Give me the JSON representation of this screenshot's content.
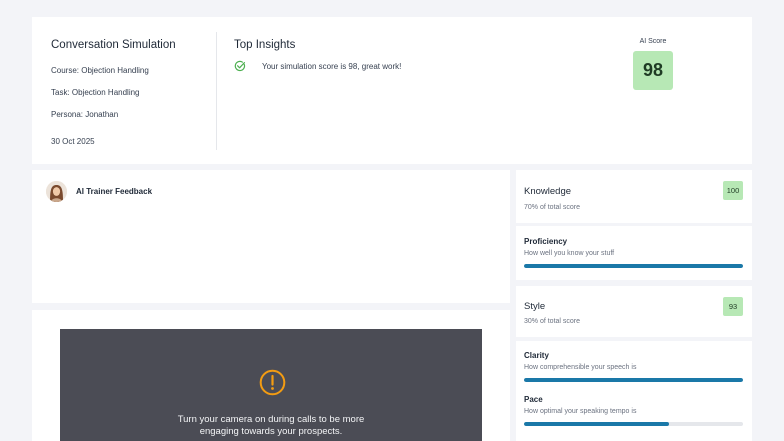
{
  "summary": {
    "title": "Conversation Simulation",
    "course": "Course: Objection Handling",
    "task": "Task: Objection Handling",
    "persona": "Persona: Jonathan",
    "date": "30 Oct 2025",
    "insights_title": "Top Insights",
    "insights": [
      "Your simulation score is 98, great work!"
    ],
    "score_label": "AI Score",
    "score": "98"
  },
  "feedback": {
    "title": "AI Trainer Feedback"
  },
  "video": {
    "message_line1": "Turn your camera on during calls to be more",
    "message_line2": "engaging towards your prospects."
  },
  "knowledge": {
    "title": "Knowledge",
    "subtitle": "70% of total score",
    "score": "100",
    "metrics": [
      {
        "title": "Proficiency",
        "subtitle": "How well you know your stuff",
        "level": 1.0
      }
    ]
  },
  "style": {
    "title": "Style",
    "subtitle": "30% of total score",
    "score": "93",
    "metrics": [
      {
        "title": "Clarity",
        "subtitle": "How comprehensible your speech is",
        "level": 1.0
      },
      {
        "title": "Pace",
        "subtitle": "How optimal your speaking tempo is",
        "level": 0.66
      }
    ]
  },
  "colors": {
    "score_bg": "#b7e8b5",
    "bar_fill": "#1a78a8",
    "check_green": "#4caf50",
    "warning_orange": "#f39c12",
    "video_bg": "#4b4c55"
  }
}
